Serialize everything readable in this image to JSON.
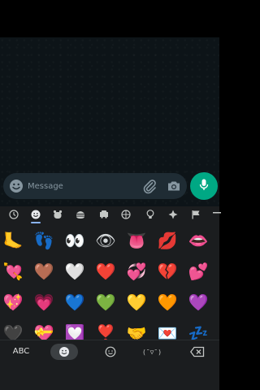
{
  "composer": {
    "placeholder": "Message"
  },
  "keyboard": {
    "categories": [
      "recent",
      "smileys",
      "animals",
      "food",
      "travel",
      "activities",
      "objects",
      "symbols",
      "flags"
    ],
    "active_category": "smileys",
    "emoji_rows": [
      [
        "🦶",
        "👣",
        "👀",
        "👁",
        "👅",
        "💋",
        "👄"
      ],
      [
        "💘",
        "🤎",
        "🤍",
        "❤️",
        "💞",
        "💔",
        "💕"
      ],
      [
        "💖",
        "💗",
        "💙",
        "💚",
        "💛",
        "🧡",
        "💜"
      ],
      [
        "🖤",
        "💝",
        "💟",
        "❣️",
        "🤝",
        "💌",
        "💤"
      ]
    ],
    "bottom": {
      "abc_label": "ABC",
      "kaomoji_label": "(¯▽¯)"
    }
  },
  "colors": {
    "background": "#000000",
    "chat_bg": "#0d1418",
    "composer_bg": "#1f2c34",
    "accent_green": "#00a884",
    "keyboard_bg": "#1b1d1f",
    "icon_gray": "#8696a0"
  }
}
